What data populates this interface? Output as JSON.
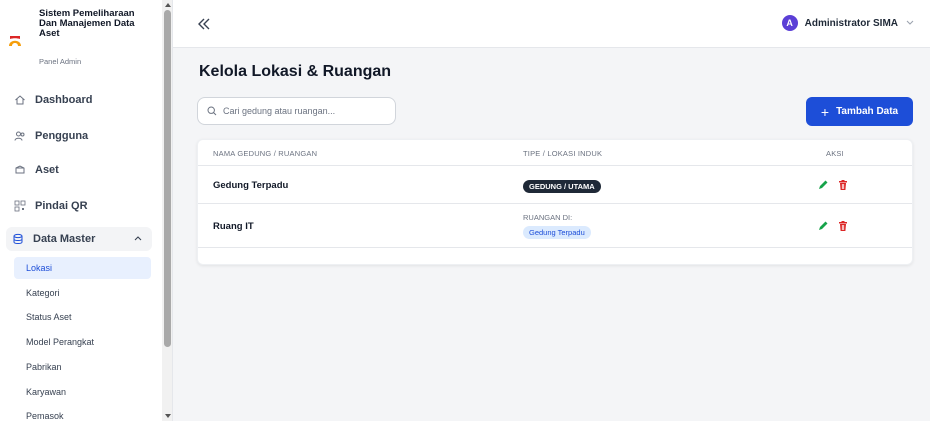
{
  "sidebar": {
    "brand_title": "Sistem Pemeliharaan Dan Manajemen Data Aset",
    "brand_subtitle": "Panel Admin",
    "nav": [
      {
        "label": "Dashboard",
        "icon": "home-icon"
      },
      {
        "label": "Pengguna",
        "icon": "users-icon"
      },
      {
        "label": "Aset",
        "icon": "box-icon"
      },
      {
        "label": "Pindai QR",
        "icon": "qr-icon"
      },
      {
        "label": "Data Master",
        "icon": "database-icon"
      }
    ],
    "submenu": [
      {
        "label": "Lokasi",
        "active": true
      },
      {
        "label": "Kategori"
      },
      {
        "label": "Status Aset"
      },
      {
        "label": "Model Perangkat"
      },
      {
        "label": "Pabrikan"
      },
      {
        "label": "Karyawan"
      },
      {
        "label": "Pemasok"
      }
    ]
  },
  "topbar": {
    "user_initial": "A",
    "user_name": "Administrator SIMA"
  },
  "main": {
    "title": "Kelola Lokasi & Ruangan",
    "search_placeholder": "Cari gedung atau ruangan...",
    "add_label": "Tambah Data",
    "columns": [
      "NAMA GEDUNG / RUANGAN",
      "TIPE / LOKASI INDUK",
      "AKSI"
    ],
    "rows": [
      {
        "name": "Gedung Terpadu",
        "type_badge": "GEDUNG / UTAMA"
      },
      {
        "name": "Ruang IT",
        "type_label": "RUANGAN DI:",
        "parent": "Gedung Terpadu"
      }
    ]
  },
  "colors": {
    "primary": "#1d4ed8",
    "avatar": "#5b3fd6",
    "edit": "#16a34a",
    "delete": "#dc2626"
  }
}
